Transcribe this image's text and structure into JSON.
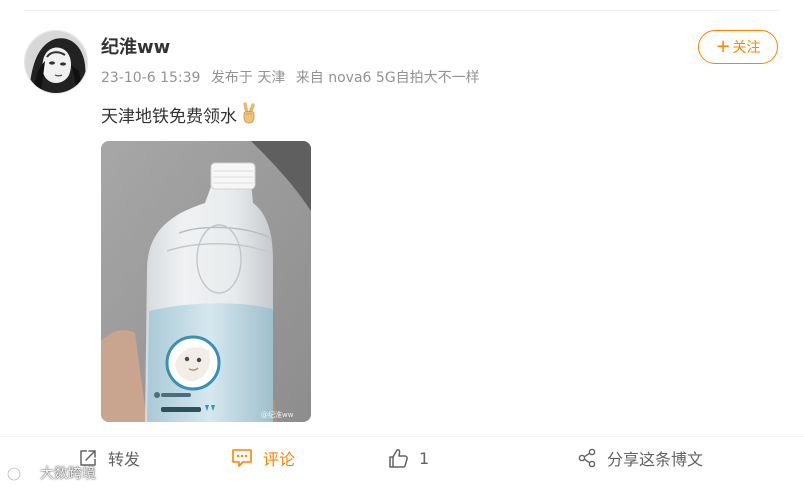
{
  "post": {
    "username": "纪淮ww",
    "timestamp": "23-10-6 15:39",
    "location": "发布于 天津",
    "source": "来自 nova6 5G自拍大不一样",
    "text": "天津地铁免费领水",
    "emoji": "victory-hand",
    "follow_label": "关注",
    "image_watermark": "@纪淮ww"
  },
  "actions": {
    "repost_label": "转发",
    "comment_label": "评论",
    "like_count": "1",
    "share_label": "分享这条博文"
  },
  "watermark": {
    "text": "大数跨境"
  },
  "colors": {
    "accent": "#ff8200",
    "text_primary": "#333333",
    "text_meta": "#939393",
    "action_gray": "#636363"
  },
  "icons": {
    "follow": "plus-icon",
    "repost": "repost-icon",
    "comment": "comment-icon",
    "like": "thumbs-up-icon",
    "share": "share-icon"
  }
}
